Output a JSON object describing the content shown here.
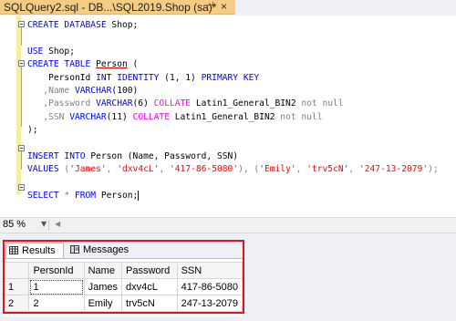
{
  "tab": {
    "title": "SQLQuery2.sql - DB...\\SQL2019.Shop (sa)*",
    "pin_icon": "pin-icon",
    "close_icon": "close-icon"
  },
  "editor": {
    "line1": {
      "kw": "CREATE DATABASE",
      "rest": " Shop;"
    },
    "line3": {
      "kw": "USE",
      "rest": " Shop;"
    },
    "line4": {
      "kw": "CREATE TABLE",
      "name": "Person",
      "rest": " ("
    },
    "line5": {
      "col": "    PersonId ",
      "kw": "INT IDENTITY",
      "args": " (1, 1) ",
      "kw2": "PRIMARY KEY"
    },
    "line6": {
      "lead": "   ,Name ",
      "kw": "VARCHAR",
      "args": "(100)"
    },
    "line7": {
      "lead": "   ,Password ",
      "kw": "VARCHAR",
      "args": "(6) ",
      "kw2": "COLLATE",
      "coll": " Latin1_General_BIN2 ",
      "nn": "not null"
    },
    "line8": {
      "lead": "   ,SSN ",
      "kw": "VARCHAR",
      "args": "(11) ",
      "kw2": "COLLATE",
      "coll": " Latin1_General_BIN2 ",
      "nn": "not null"
    },
    "line9": ");",
    "line11": {
      "kw": "INSERT INTO",
      "rest": " Person (Name, Password, SSN)"
    },
    "line12": {
      "kw": "VALUES",
      "p1": " (",
      "s1": "'James'",
      "c1": ", ",
      "s2": "'dxv4cL'",
      "c2": ", ",
      "s3": "'417-86-5080'",
      "p2": "), (",
      "s4": "'Emily'",
      "c4": ", ",
      "s5": "'trv5cN'",
      "c5": ", ",
      "s6": "'247-13-2079'",
      "p3": ");"
    },
    "line14": {
      "kw": "SELECT",
      "rest": " * ",
      "kw2": "FROM",
      "rest2": " Person;"
    }
  },
  "status": {
    "zoom": "85 %",
    "zoom_arrow_icon": "chevron-down-icon"
  },
  "results": {
    "tabs": [
      {
        "label": "Results",
        "icon": "grid-icon",
        "active": true
      },
      {
        "label": "Messages",
        "icon": "messages-icon",
        "active": false
      }
    ],
    "columns": [
      "PersonId",
      "Name",
      "Password",
      "SSN"
    ],
    "rows": [
      {
        "row_num": "1",
        "cells": [
          "1",
          "James",
          "dxv4cL",
          "417-86-5080"
        ]
      },
      {
        "row_num": "2",
        "cells": [
          "2",
          "Emily",
          "trv5cN",
          "247-13-2079"
        ]
      }
    ]
  },
  "colors": {
    "tab_active": "#f5cc84",
    "keyword": "#0000ff",
    "string": "#ff0000",
    "function": "#ff00ff",
    "comment_gray": "#808080",
    "highlight_border": "#e8101a"
  }
}
